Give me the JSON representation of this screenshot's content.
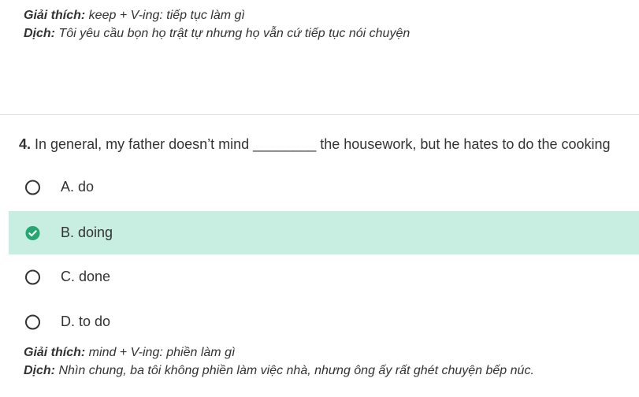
{
  "previous_explanation": {
    "explain_label": "Giải thích:",
    "explain_text": " keep + V-ing: tiếp tục làm gì",
    "translate_label": "Dịch:",
    "translate_text": " Tôi yêu cầu bọn họ trật tự nhưng họ vẫn cứ tiếp tục nói chuyện"
  },
  "question": {
    "number": "4.",
    "text": " In general, my father doesn’t mind ________ the housework, but he hates to do the cooking"
  },
  "options": [
    {
      "label": "A. do",
      "selected": false
    },
    {
      "label": "B. doing",
      "selected": true
    },
    {
      "label": "C. done",
      "selected": false
    },
    {
      "label": "D. to do",
      "selected": false
    }
  ],
  "explanation": {
    "explain_label": "Giải thích:",
    "explain_text": " mind + V-ing: phiền làm gì",
    "translate_label": "Dịch:",
    "translate_text": " Nhìn chung, ba tôi không phiền làm việc nhà, nhưng ông ấy rất ghét chuyện bếp núc."
  },
  "colors": {
    "selected_bg": "#c8ede1",
    "check_green": "#26a772",
    "text": "#333333"
  },
  "icons": {
    "correct": "check-circle-icon",
    "unselected": "radio-circle-icon"
  }
}
